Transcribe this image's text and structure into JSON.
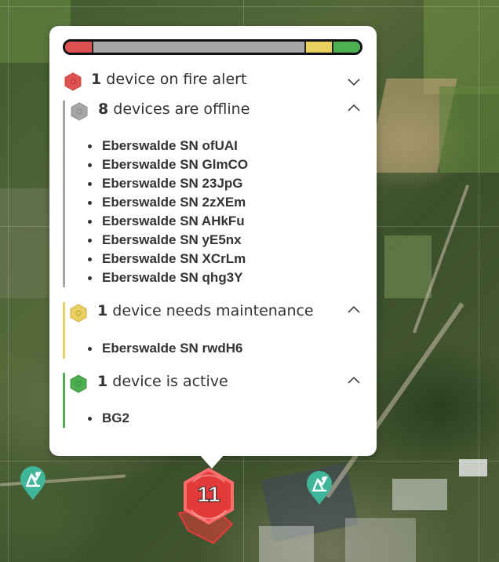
{
  "colors": {
    "fire": "#e05252",
    "offline": "#a6a6a6",
    "maintenance": "#e8cf5e",
    "active": "#4caf50",
    "pin": "#3fb59a",
    "cluster": "#e53a3a"
  },
  "status_bar": {
    "segments": [
      {
        "status": "fire",
        "fraction": 0.0909
      },
      {
        "status": "offline",
        "fraction": 0.7273
      },
      {
        "status": "maintenance",
        "fraction": 0.0909
      },
      {
        "status": "active",
        "fraction": 0.0909
      }
    ]
  },
  "groups": {
    "fire": {
      "count": "1",
      "label": "device on fire alert",
      "icon": "fire-hexagon-icon",
      "chevron": "chevron-down-icon",
      "devices": []
    },
    "offline": {
      "count": "8",
      "label": "devices are offline",
      "icon": "offline-hexagon-icon",
      "chevron": "chevron-up-icon",
      "devices": [
        "Eberswalde SN ofUAI",
        "Eberswalde SN GlmCO",
        "Eberswalde SN 23JpG",
        "Eberswalde SN 2zXEm",
        "Eberswalde SN AHkFu",
        "Eberswalde SN yE5nx",
        "Eberswalde SN XCrLm",
        "Eberswalde SN qhg3Y"
      ]
    },
    "maintenance": {
      "count": "1",
      "label": "device needs maintenance",
      "icon": "maintenance-hexagon-icon",
      "chevron": "chevron-up-icon",
      "devices": [
        "Eberswalde SN rwdH6"
      ]
    },
    "active": {
      "count": "1",
      "label": "device is active",
      "icon": "active-hexagon-icon",
      "chevron": "chevron-up-icon",
      "devices": [
        "BG2"
      ]
    }
  },
  "map": {
    "cluster_count": "11",
    "pin_icon": "radar-sensor-pin-icon"
  }
}
